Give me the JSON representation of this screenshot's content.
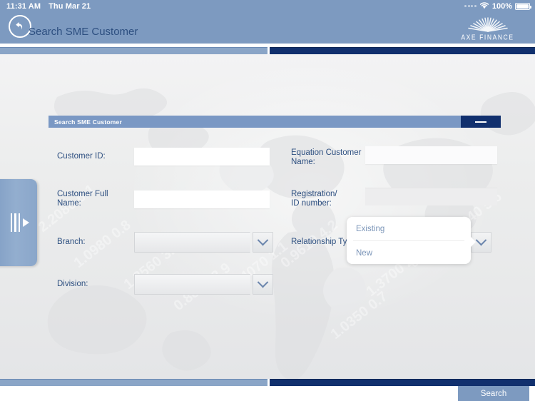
{
  "statusbar": {
    "time": "11:31 AM",
    "date": "Thu Mar 21",
    "battery_percent": "100%",
    "wifi_icon": "wifi-icon",
    "battery_icon": "battery-full-icon"
  },
  "appbar": {
    "back_icon": "back-arrow-icon",
    "title": "Search SME Customer",
    "logo_text": "AXE FINANCE",
    "logo_icon": "sunburst-logo-icon"
  },
  "drawer": {
    "handle_icon": "drawer-expand-handle-icon"
  },
  "panel": {
    "header_title": "Search SME Customer",
    "minimize_icon": "minimize-icon"
  },
  "form": {
    "customer_id": {
      "label": "Customer ID:",
      "value": "",
      "placeholder": ""
    },
    "equation_customer_name": {
      "label": "Equation Customer\nName:",
      "value": "",
      "placeholder": ""
    },
    "customer_full_name": {
      "label": "Customer Full Name:",
      "value": "",
      "placeholder": ""
    },
    "registration_id_number": {
      "label": "Registration/\nID number:",
      "value": "",
      "placeholder": ""
    },
    "branch": {
      "label": "Branch:",
      "value": "",
      "chevron_icon": "chevron-down-icon"
    },
    "division": {
      "label": "Division:",
      "value": "",
      "chevron_icon": "chevron-down-icon"
    },
    "relationship_type": {
      "label": "Relationship Type:",
      "value": "",
      "chevron_icon": "chevron-down-icon"
    }
  },
  "popover": {
    "options": [
      {
        "label": "Existing"
      },
      {
        "label": "New"
      }
    ]
  },
  "footer": {
    "search_label": "Search"
  },
  "colors": {
    "header_blue": "#7d9ac0",
    "panel_header_blue": "#7a98c4",
    "navy": "#11306e",
    "label_blue": "#2d4f80",
    "option_text": "#7b95b8",
    "page_bg": "#eceded"
  }
}
